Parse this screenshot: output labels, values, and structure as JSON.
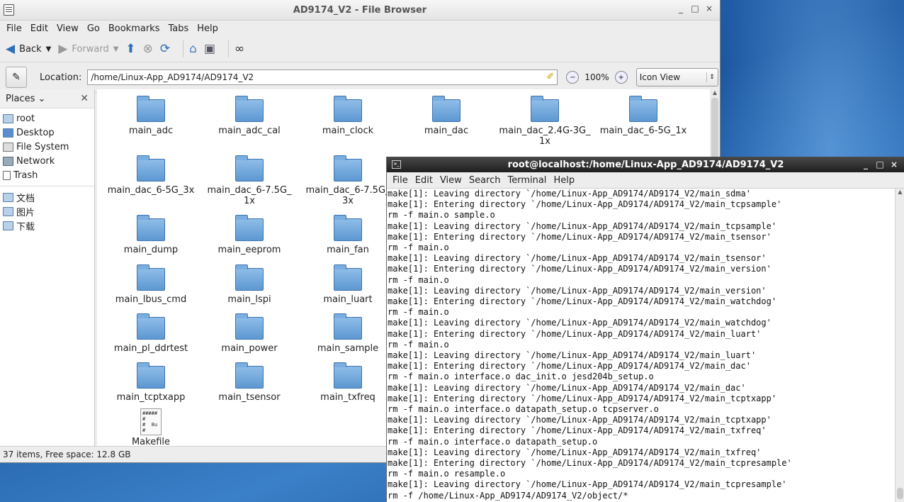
{
  "file_browser": {
    "title": "AD9174_V2 - File Browser",
    "window_buttons": [
      "_",
      "□",
      "×"
    ],
    "menu": [
      "File",
      "Edit",
      "View",
      "Go",
      "Bookmarks",
      "Tabs",
      "Help"
    ],
    "toolbar": {
      "back": "Back",
      "forward": "Forward"
    },
    "location_label": "Location:",
    "location": "/home/Linux-App_AD9174/AD9174_V2",
    "zoom": "100%",
    "view_mode": "Icon View",
    "places_label": "Places",
    "places": [
      "root",
      "Desktop",
      "File System",
      "Network",
      "Trash"
    ],
    "bookmarks": [
      "文档",
      "图片",
      "下载"
    ],
    "items": [
      {
        "label": "main_adc",
        "type": "folder"
      },
      {
        "label": "main_adc_cal",
        "type": "folder"
      },
      {
        "label": "main_clock",
        "type": "folder"
      },
      {
        "label": "main_dac",
        "type": "folder"
      },
      {
        "label": "main_dac_2.4G-3G_\n1x",
        "type": "folder"
      },
      {
        "label": "main_dac_6-5G_1x",
        "type": "folder"
      },
      {
        "label": "main_dac_6-5G_3x",
        "type": "folder"
      },
      {
        "label": "main_dac_6-7.5G_\n1x",
        "type": "folder"
      },
      {
        "label": "main_dac_6-7.5G_\n3x",
        "type": "folder"
      },
      {
        "label": "main_dump",
        "type": "folder"
      },
      {
        "label": "main_eeprom",
        "type": "folder"
      },
      {
        "label": "main_fan",
        "type": "folder"
      },
      {
        "label": "main_lbus_cmd",
        "type": "folder"
      },
      {
        "label": "main_lspi",
        "type": "folder"
      },
      {
        "label": "main_luart",
        "type": "folder"
      },
      {
        "label": "main_pl_ddrtest",
        "type": "folder"
      },
      {
        "label": "main_power",
        "type": "folder"
      },
      {
        "label": "main_sample",
        "type": "folder"
      },
      {
        "label": "main_tcptxapp",
        "type": "folder"
      },
      {
        "label": "main_tsensor",
        "type": "folder"
      },
      {
        "label": "main_txfreq",
        "type": "folder"
      },
      {
        "label": "Makefile",
        "type": "file"
      }
    ],
    "status": "37 items, Free space: 12.8 GB"
  },
  "terminal": {
    "title": "root@localhost:/home/Linux-App_AD9174/AD9174_V2",
    "menu": [
      "File",
      "Edit",
      "View",
      "Search",
      "Terminal",
      "Help"
    ],
    "lines": [
      "make[1]: Leaving directory `/home/Linux-App_AD9174/AD9174_V2/main_sdma'",
      "make[1]: Entering directory `/home/Linux-App_AD9174/AD9174_V2/main_tcpsample'",
      "rm -f main.o sample.o",
      "make[1]: Leaving directory `/home/Linux-App_AD9174/AD9174_V2/main_tcpsample'",
      "make[1]: Entering directory `/home/Linux-App_AD9174/AD9174_V2/main_tsensor'",
      "rm -f main.o",
      "make[1]: Leaving directory `/home/Linux-App_AD9174/AD9174_V2/main_tsensor'",
      "make[1]: Entering directory `/home/Linux-App_AD9174/AD9174_V2/main_version'",
      "rm -f main.o",
      "make[1]: Leaving directory `/home/Linux-App_AD9174/AD9174_V2/main_version'",
      "make[1]: Entering directory `/home/Linux-App_AD9174/AD9174_V2/main_watchdog'",
      "rm -f main.o",
      "make[1]: Leaving directory `/home/Linux-App_AD9174/AD9174_V2/main_watchdog'",
      "make[1]: Entering directory `/home/Linux-App_AD9174/AD9174_V2/main_luart'",
      "rm -f main.o",
      "make[1]: Leaving directory `/home/Linux-App_AD9174/AD9174_V2/main_luart'",
      "make[1]: Entering directory `/home/Linux-App_AD9174/AD9174_V2/main_dac'",
      "rm -f main.o interface.o dac_init.o jesd204b_setup.o",
      "make[1]: Leaving directory `/home/Linux-App_AD9174/AD9174_V2/main_dac'",
      "make[1]: Entering directory `/home/Linux-App_AD9174/AD9174_V2/main_tcptxapp'",
      "rm -f main.o interface.o datapath_setup.o tcpserver.o",
      "make[1]: Leaving directory `/home/Linux-App_AD9174/AD9174_V2/main_tcptxapp'",
      "make[1]: Entering directory `/home/Linux-App_AD9174/AD9174_V2/main_txfreq'",
      "rm -f main.o interface.o datapath_setup.o",
      "make[1]: Leaving directory `/home/Linux-App_AD9174/AD9174_V2/main_txfreq'",
      "make[1]: Entering directory `/home/Linux-App_AD9174/AD9174_V2/main_tcpresample'",
      "rm -f main.o resample.o",
      "make[1]: Leaving directory `/home/Linux-App_AD9174/AD9174_V2/main_tcpresample'",
      "rm -f /home/Linux-App_AD9174/AD9174_V2/object/*"
    ]
  }
}
